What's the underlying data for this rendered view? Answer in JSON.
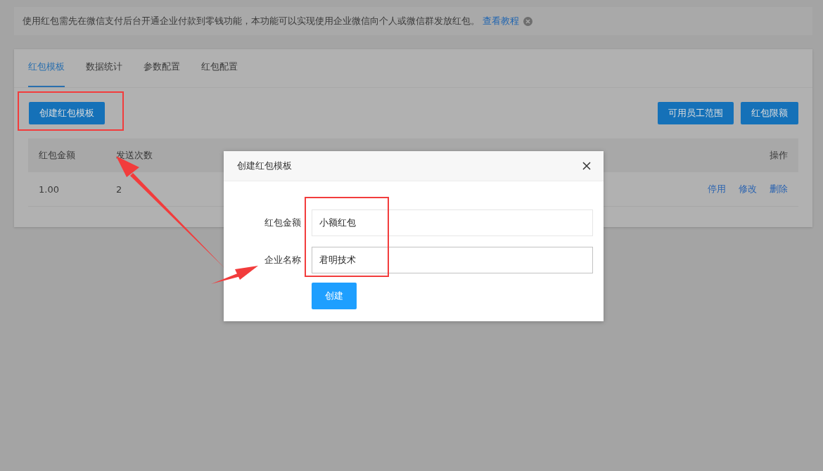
{
  "notice": {
    "text": "使用红包需先在微信支付后台开通企业付款到零钱功能，本功能可以实现使用企业微信向个人或微信群发放红包。",
    "link": "查看教程"
  },
  "tabs": [
    {
      "label": "红包模板",
      "selected": true
    },
    {
      "label": "数据统计",
      "selected": false
    },
    {
      "label": "参数配置",
      "selected": false
    },
    {
      "label": "红包配置",
      "selected": false
    }
  ],
  "toolbar": {
    "primary": "创建红包模板",
    "actions": [
      "可用员工范围",
      "红包限额"
    ]
  },
  "table": {
    "columns": [
      "红包金额",
      "发送次数",
      "操作"
    ],
    "rows": [
      {
        "cells": [
          "1.00",
          "2"
        ],
        "actions": [
          "停用",
          "修改",
          "删除"
        ]
      }
    ]
  },
  "dialog": {
    "title": "创建红包模板",
    "fields": [
      {
        "label": "红包金额",
        "value": "小额红包",
        "focused": false
      },
      {
        "label": "企业名称",
        "value": "君明技术",
        "focused": true
      }
    ],
    "submit": "创建"
  }
}
